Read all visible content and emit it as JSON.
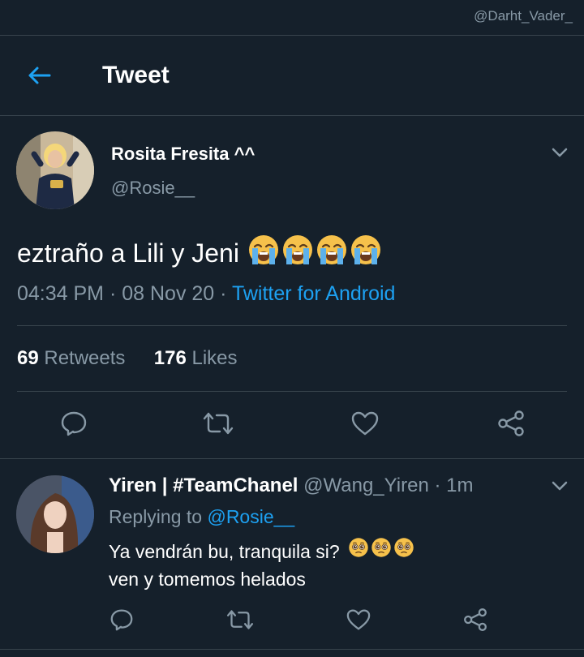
{
  "watermark": "@Darht_Vader_",
  "header": {
    "title": "Tweet"
  },
  "tweet": {
    "author_name": "Rosita Fresita ^^",
    "author_handle": "@Rosie__",
    "text": "eztraño a Lili y Jeni",
    "emojis": [
      "loudly-crying-face",
      "loudly-crying-face",
      "loudly-crying-face",
      "loudly-crying-face"
    ],
    "time": "04:34 PM",
    "date": "08 Nov 20",
    "separator": " · ",
    "source": "Twitter for Android",
    "retweets_count": "69",
    "retweets_label": "Retweets",
    "likes_count": "176",
    "likes_label": "Likes"
  },
  "reply": {
    "author_name": "Yiren | #TeamChanel",
    "author_handle": "@Wang_Yiren",
    "time": "· 1m",
    "replying_prefix": "Replying to",
    "replying_to": "@Rosie__",
    "line1": "Ya vendrán bu, tranquila si?",
    "emojis": [
      "pleading-face",
      "pleading-face",
      "pleading-face"
    ],
    "line2": "ven y tomemos helados"
  },
  "colors": {
    "background": "#15202b",
    "divider": "#38444d",
    "accent": "#1da1f2",
    "secondary_text": "#8899a6"
  }
}
